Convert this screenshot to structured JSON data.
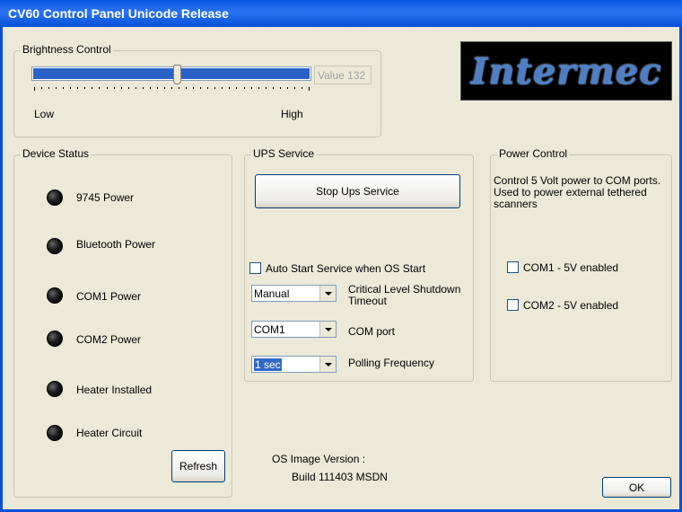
{
  "window": {
    "title": "CV60 Control Panel Unicode Release"
  },
  "brightness": {
    "legend": "Brightness Control",
    "value_text": "Value 132",
    "low_label": "Low",
    "high_label": "High",
    "level": 132,
    "max": 255
  },
  "logo": {
    "text": "Intermec"
  },
  "device_status": {
    "legend": "Device Status",
    "items": [
      {
        "label": "9745 Power"
      },
      {
        "label": "Bluetooth Power"
      },
      {
        "label": "COM1 Power"
      },
      {
        "label": "COM2 Power"
      },
      {
        "label": "Heater Installed"
      },
      {
        "label": "Heater Circuit"
      }
    ],
    "refresh_label": "Refresh"
  },
  "ups": {
    "legend": "UPS Service",
    "stop_button": "Stop Ups Service",
    "auto_start_label": "Auto Start Service when OS Start",
    "critical_value": "Manual",
    "critical_label_line1": "Critical Level Shutdown",
    "critical_label_line2": "Timeout",
    "com_value": "COM1",
    "com_label": "COM port",
    "poll_value": "1 sec",
    "poll_label": "Polling Frequency"
  },
  "power": {
    "legend": "Power Control",
    "desc_line1": "Control 5 Volt power to COM ports.",
    "desc_line2": "Used to power external tethered",
    "desc_line3": "scanners",
    "com1_label": "COM1 - 5V enabled",
    "com2_label": "COM2 - 5V enabled"
  },
  "os": {
    "label": "OS Image Version :",
    "build": "Build 111403 MSDN"
  },
  "ok_label": "OK"
}
